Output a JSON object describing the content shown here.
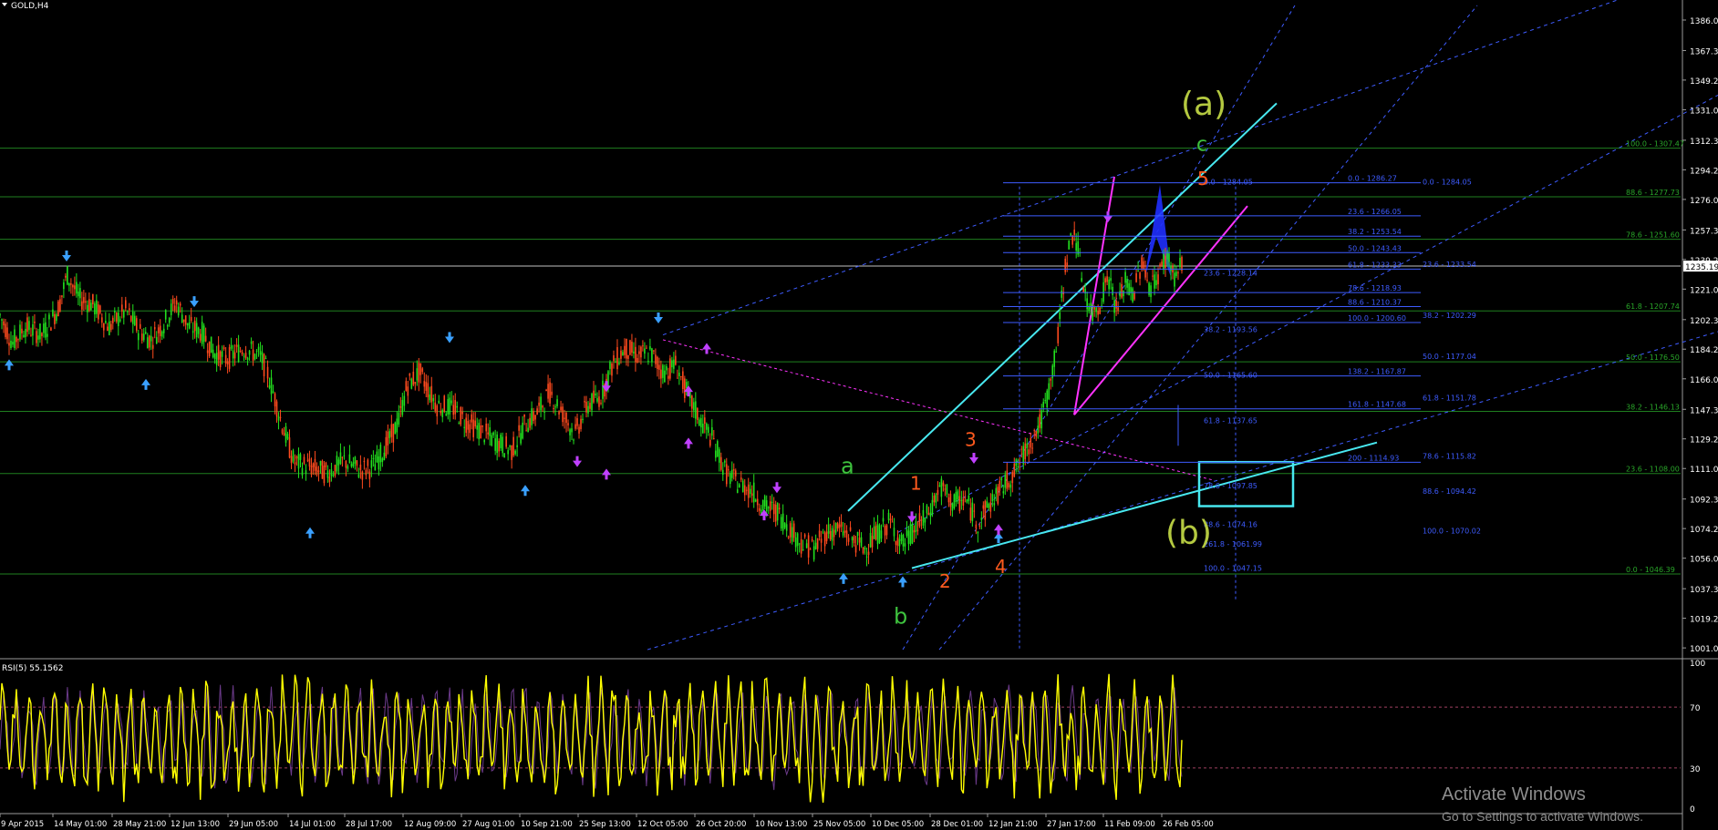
{
  "chart_data": {
    "type": "candlestick",
    "symbol_label": "GOLD,H4",
    "price_axis": {
      "range": [
        995,
        1395
      ],
      "ticks": [
        "1001.07",
        "1019.25",
        "1037.37",
        "1056.07",
        "1074.25",
        "1092.37",
        "1111.07",
        "1129.25",
        "1147.37",
        "1166.07",
        "1184.25",
        "1202.37",
        "1221.07",
        "1239.25",
        "1257.37",
        "1276.07",
        "1294.25",
        "1312.37",
        "1331.07",
        "1349.25",
        "1367.37",
        "1386.07"
      ],
      "current_price": "1235.19"
    },
    "time_axis": {
      "labels": [
        "9 Apr 2015",
        "14 May 01:00",
        "28 May 21:00",
        "12 Jun 13:00",
        "29 Jun 05:00",
        "14 Jul 01:00",
        "28 Jul 17:00",
        "12 Aug 09:00",
        "27 Aug 01:00",
        "10 Sep 21:00",
        "25 Sep 13:00",
        "12 Oct 05:00",
        "26 Oct 20:00",
        "10 Nov 13:00",
        "25 Nov 05:00",
        "10 Dec 05:00",
        "28 Dec 01:00",
        "12 Jan 21:00",
        "27 Jan 17:00",
        "11 Feb 09:00",
        "26 Feb 05:00"
      ]
    },
    "price_path": [
      [
        0,
        1205
      ],
      [
        1.5,
        1188
      ],
      [
        3,
        1198
      ],
      [
        5,
        1193
      ],
      [
        7,
        1210
      ],
      [
        8,
        1230
      ],
      [
        9.5,
        1215
      ],
      [
        11,
        1212
      ],
      [
        13,
        1198
      ],
      [
        15,
        1208
      ],
      [
        16.5,
        1196
      ],
      [
        18,
        1190
      ],
      [
        19.5,
        1200
      ],
      [
        21,
        1213
      ],
      [
        22.5,
        1198
      ],
      [
        24,
        1195
      ],
      [
        25.5,
        1182
      ],
      [
        27,
        1178
      ],
      [
        29,
        1185
      ],
      [
        31,
        1180
      ],
      [
        32,
        1168
      ],
      [
        33.5,
        1140
      ],
      [
        35,
        1115
      ],
      [
        37,
        1112
      ],
      [
        39,
        1108
      ],
      [
        41,
        1116
      ],
      [
        43,
        1110
      ],
      [
        44.5,
        1112
      ],
      [
        46,
        1125
      ],
      [
        47.5,
        1140
      ],
      [
        48.5,
        1162
      ],
      [
        50,
        1170
      ],
      [
        52,
        1150
      ],
      [
        54,
        1148
      ],
      [
        55.5,
        1140
      ],
      [
        57,
        1135
      ],
      [
        59,
        1128
      ],
      [
        61,
        1122
      ],
      [
        62.5,
        1138
      ],
      [
        64,
        1145
      ],
      [
        65.5,
        1158
      ],
      [
        67,
        1145
      ],
      [
        68.5,
        1132
      ],
      [
        70,
        1150
      ],
      [
        71.5,
        1155
      ],
      [
        73,
        1175
      ],
      [
        74.5,
        1185
      ],
      [
        76,
        1180
      ],
      [
        77.5,
        1182
      ],
      [
        79,
        1170
      ],
      [
        80.5,
        1175
      ],
      [
        82,
        1155
      ],
      [
        83.5,
        1140
      ],
      [
        85,
        1128
      ],
      [
        86.5,
        1108
      ],
      [
        88,
        1102
      ],
      [
        89.5,
        1098
      ],
      [
        91,
        1088
      ],
      [
        92.5,
        1085
      ],
      [
        94,
        1075
      ],
      [
        95.5,
        1065
      ],
      [
        97,
        1062
      ],
      [
        98.5,
        1072
      ],
      [
        100,
        1074
      ],
      [
        101.5,
        1068
      ],
      [
        103,
        1062
      ],
      [
        104.5,
        1071
      ],
      [
        106,
        1078
      ],
      [
        107.5,
        1064
      ],
      [
        109,
        1074
      ],
      [
        110.5,
        1082
      ],
      [
        112,
        1100
      ],
      [
        113.5,
        1090
      ],
      [
        115,
        1092
      ],
      [
        116.5,
        1078
      ],
      [
        118,
        1090
      ],
      [
        119.5,
        1100
      ],
      [
        121,
        1110
      ],
      [
        122.5,
        1125
      ],
      [
        124,
        1140
      ],
      [
        125,
        1160
      ],
      [
        126,
        1190
      ],
      [
        127,
        1240
      ],
      [
        128,
        1258
      ],
      [
        129,
        1225
      ],
      [
        130,
        1205
      ],
      [
        131,
        1212
      ],
      [
        132,
        1230
      ],
      [
        133,
        1208
      ],
      [
        134,
        1225
      ],
      [
        135,
        1218
      ],
      [
        136,
        1238
      ],
      [
        137,
        1222
      ],
      [
        138,
        1230
      ],
      [
        139,
        1242
      ],
      [
        140,
        1228
      ],
      [
        141,
        1238
      ]
    ],
    "wave_labels": [
      "(a)",
      "c",
      "5",
      "a",
      "1",
      "3",
      "b",
      "2",
      "4",
      "(b)"
    ],
    "fib_right_1": [
      "0.0 - 1286.27",
      "23.6 - 1266.05",
      "38.2 - 1253.54",
      "50.0 - 1243.43",
      "61.8 - 1233.33",
      "78.6 - 1218.93",
      "88.6 - 1210.37",
      "100.0 - 1200.60",
      "138.2 - 1167.87",
      "161.8 - 1147.68",
      "200 - 1114.93"
    ],
    "fib_right_2": [
      "0.0 - 1284.05",
      "23.6 - 1233.54",
      "38.2 - 1202.29",
      "50.0 - 1177.04",
      "61.8 - 1151.78",
      "78.6 - 1115.82",
      "88.6 - 1094.42",
      "100.0 - 1070.02"
    ],
    "fib_mid": [
      "0.0 - 1284.05",
      "23.6 - 1228.14",
      "38.2 - 1193.56",
      "50.0 - 1165.60",
      "61.8 - 1137.65",
      "78.6 - 1097.85",
      "88.6 - 1074.16",
      "100.0 - 1047.15",
      "261.8 - 1061.99"
    ],
    "fib_far": [
      "100.0 - 1307.47",
      "88.6 - 1277.73",
      "78.6 - 1251.60",
      "61.8 - 1207.74",
      "50.0 - 1176.50",
      "38.2 - 1146.13",
      "23.6 - 1108.00",
      "0.0 - 1046.39"
    ],
    "rsi": {
      "label": "RSI(5) 55.1562",
      "levels": [
        "100",
        "70",
        "30",
        "0"
      ]
    },
    "colors": {
      "bull": "#22e01e",
      "bear": "#ff4a1e",
      "green_line": "#1f7f1f",
      "fib_blue": "#3e5cff",
      "fib_green": "#29a629",
      "cyan": "#48e8f0",
      "magenta": "#ff33ff",
      "rsi": "#ffff00",
      "wave_green": "#3ec23e",
      "wave_orange": "#ff5a1e",
      "wave_olive": "#b4c940"
    }
  },
  "watermark": {
    "line1": "Activate Windows",
    "line2": "Go to Settings to activate Windows."
  }
}
